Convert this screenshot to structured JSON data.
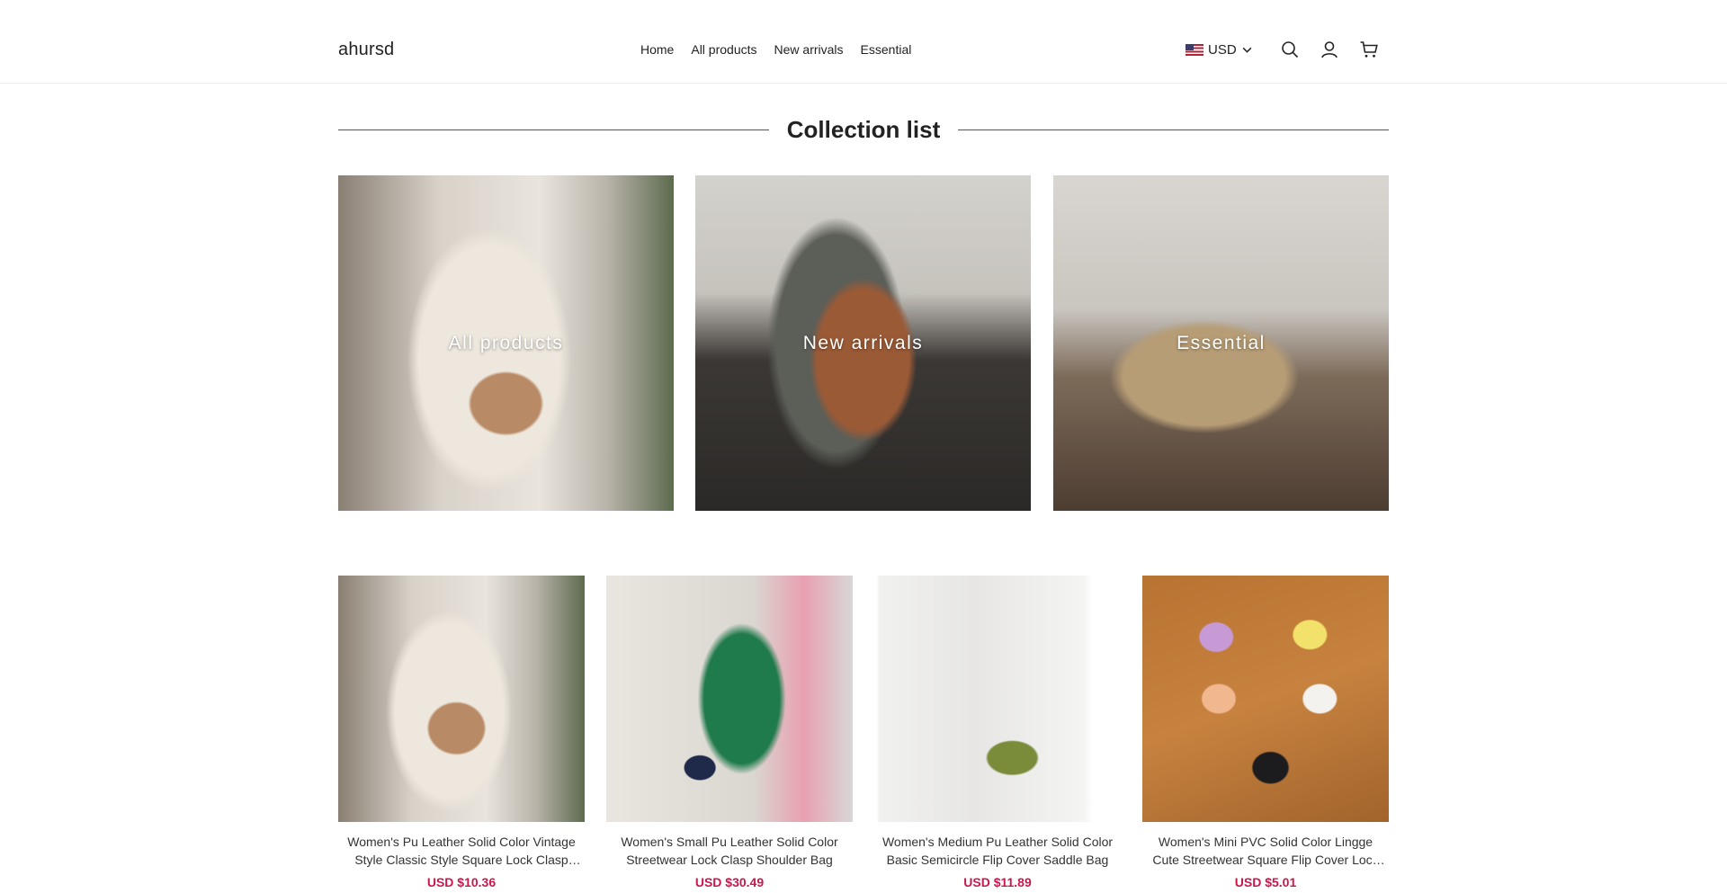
{
  "header": {
    "logo": "ahursd",
    "nav": [
      "Home",
      "All products",
      "New arrivals",
      "Essential"
    ],
    "currency": "USD",
    "icons": [
      "us-flag-icon",
      "chevron-down-icon",
      "search-icon",
      "user-icon",
      "cart-icon"
    ]
  },
  "collection": {
    "title": "Collection list",
    "tiles": [
      {
        "label": "All products"
      },
      {
        "label": "New arrivals"
      },
      {
        "label": "Essential"
      }
    ]
  },
  "products": [
    {
      "title": "Women's Pu Leather Solid Color Vintage Style Classic Style Square Lock Clasp Shoulder Bag",
      "price": "USD $10.36"
    },
    {
      "title": "Women's Small Pu Leather Solid Color Streetwear Lock Clasp Shoulder Bag",
      "price": "USD $30.49"
    },
    {
      "title": "Women's Medium Pu Leather Solid Color Basic Semicircle Flip Cover Saddle Bag",
      "price": "USD $11.89"
    },
    {
      "title": "Women's Mini PVC Solid Color Lingge Cute Streetwear Square Flip Cover Lock Clasp Crossbody Bag",
      "price": "USD $5.01"
    }
  ],
  "colors": {
    "price": "#c8174c",
    "text": "#222222"
  }
}
